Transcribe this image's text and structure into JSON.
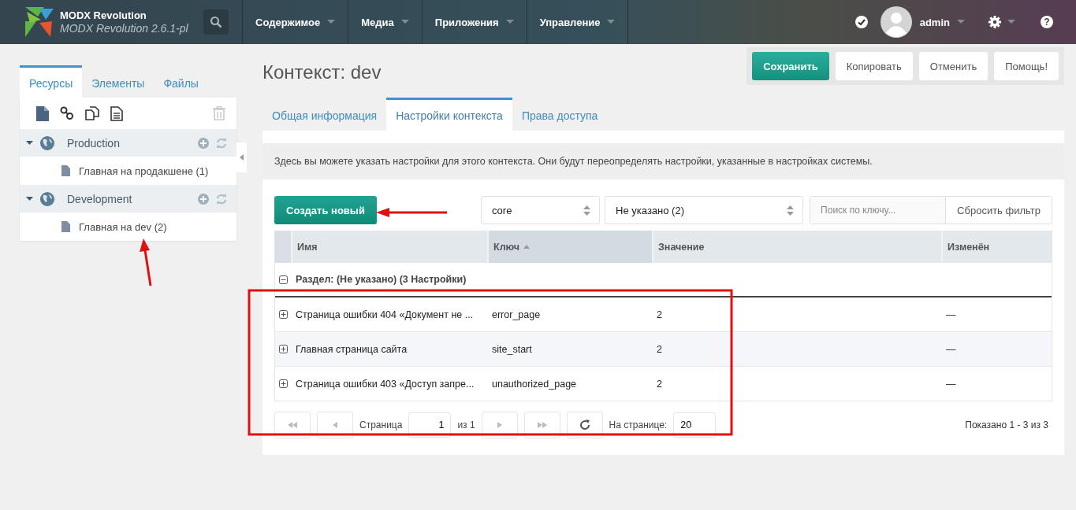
{
  "header": {
    "brand_title": "MODX Revolution",
    "brand_subtitle": "MODX Revolution 2.6.1-pl",
    "nav": [
      {
        "label": "Содержимое"
      },
      {
        "label": "Медиа"
      },
      {
        "label": "Приложения"
      },
      {
        "label": "Управление"
      }
    ],
    "user": "admin",
    "help": "?"
  },
  "action_buttons": [
    {
      "label": "Сохранить",
      "kind": "primary"
    },
    {
      "label": "Копировать",
      "kind": "default"
    },
    {
      "label": "Отменить",
      "kind": "default"
    },
    {
      "label": "Помощь!",
      "kind": "default"
    }
  ],
  "sidebar": {
    "tabs": [
      {
        "label": "Ресурсы",
        "selected": true
      },
      {
        "label": "Элементы",
        "selected": false
      },
      {
        "label": "Файлы",
        "selected": false
      }
    ],
    "tree": [
      {
        "label": "Production",
        "expanded": true,
        "children": [
          {
            "label": "Главная на продакшене (1)"
          }
        ]
      },
      {
        "label": "Development",
        "expanded": true,
        "children": [
          {
            "label": "Главная на dev (2)"
          }
        ]
      }
    ]
  },
  "page_title": "Контекст: dev",
  "tabs": [
    {
      "label": "Общая информация",
      "selected": false
    },
    {
      "label": "Настройки контекста",
      "selected": true
    },
    {
      "label": "Права доступа",
      "selected": false
    }
  ],
  "description": "Здесь вы можете указать настройки для этого контекста. Они будут переопределять настройки, указанные в настройках системы.",
  "toolbar": {
    "create_button": "Создать новый",
    "namespace": "core",
    "area": "Не указано (2)",
    "search": {
      "placeholder": "Поиск по ключу..."
    },
    "reset_button": "Сбросить фильтр"
  },
  "table": {
    "columns": [
      {
        "label": "Имя",
        "sorted": false
      },
      {
        "label": "Ключ",
        "sorted": true
      },
      {
        "label": "Значение",
        "sorted": false
      },
      {
        "label": "Изменён",
        "sorted": false
      }
    ],
    "group": {
      "label": "Раздел: (Не указано) (3 Настройки)",
      "expanded": true
    },
    "rows": [
      {
        "name": "Страница ошибки 404 «Документ не ...",
        "key": "error_page",
        "value": "2",
        "edited": "—",
        "expanded": false
      },
      {
        "name": "Главная страница сайта",
        "key": "site_start",
        "value": "2",
        "edited": "—",
        "expanded": false
      },
      {
        "name": "Страница ошибки 403 «Доступ запре...",
        "key": "unauthorized_page",
        "value": "2",
        "edited": "—",
        "expanded": false
      }
    ]
  },
  "pagination": {
    "page_label": "Страница",
    "page": "1",
    "of": "из 1",
    "per_page_label": "На странице:",
    "per_page": "20",
    "summary": "Показано 1 - 3 из 3"
  }
}
